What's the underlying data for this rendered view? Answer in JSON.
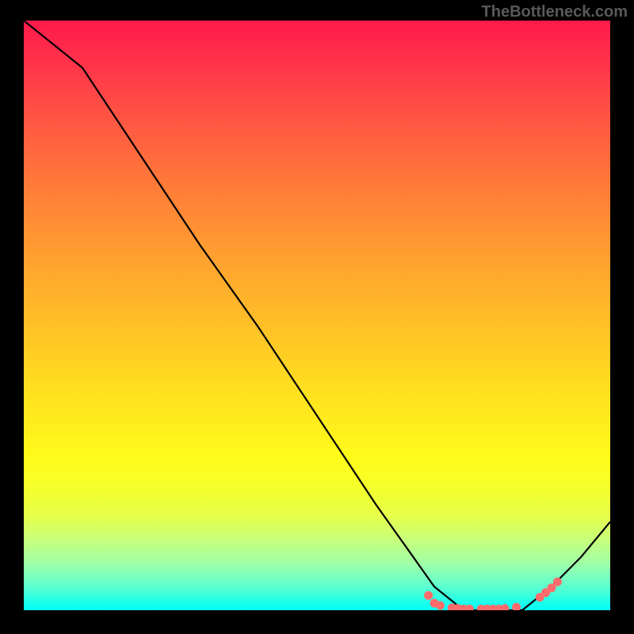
{
  "watermark": "TheBottleneck.com",
  "chart_data": {
    "type": "line",
    "title": "",
    "xlabel": "",
    "ylabel": "",
    "xlim": [
      0,
      100
    ],
    "ylim": [
      0,
      100
    ],
    "series": [
      {
        "name": "bottleneck-curve",
        "x": [
          0,
          10,
          20,
          30,
          40,
          50,
          60,
          70,
          75,
          80,
          85,
          90,
          95,
          100
        ],
        "y": [
          100,
          92,
          77,
          62,
          48,
          33,
          18,
          4,
          0,
          0,
          0,
          4,
          9,
          15
        ]
      }
    ],
    "markers": {
      "name": "highlight-points",
      "x": [
        69,
        70,
        71,
        73,
        74,
        75,
        76,
        78,
        79,
        80,
        81,
        82,
        84,
        88,
        89,
        90,
        91
      ],
      "y": [
        2.5,
        1.2,
        0.8,
        0.4,
        0.3,
        0.2,
        0.2,
        0.2,
        0.2,
        0.2,
        0.2,
        0.3,
        0.5,
        2.2,
        3.0,
        3.8,
        4.8
      ]
    },
    "colors": {
      "curve": "#000000",
      "markers": "#ff6b6b",
      "gradient_top": "#ff1a4a",
      "gradient_mid": "#ffe31f",
      "gradient_bottom": "#06fff7"
    }
  }
}
